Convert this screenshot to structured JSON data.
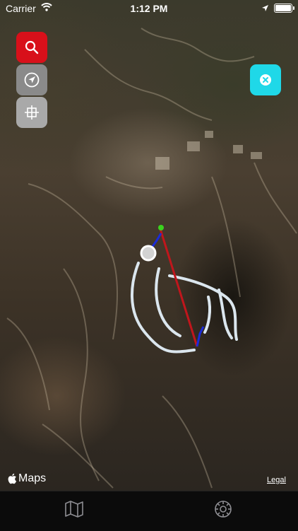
{
  "status_bar": {
    "carrier": "Carrier",
    "time": "1:12 PM",
    "icons": [
      "wifi-icon",
      "location-arrow-icon",
      "battery-icon"
    ]
  },
  "map": {
    "attribution": "Maps",
    "legal_label": "Legal",
    "route_colors": {
      "line": "#c0161c",
      "start": "#3bd21e",
      "end": "#1a2bd9",
      "trail": "#dce7f0"
    }
  },
  "map_controls": {
    "search": {
      "icon": "search-icon",
      "color": "#d8101a"
    },
    "locate": {
      "icon": "location-arrow-icon",
      "color": "#8a8a8a"
    },
    "tracking": {
      "icon": "crosshair-icon",
      "color": "#a9a9a9"
    },
    "close": {
      "icon": "close-icon",
      "color": "#1fd8e8"
    }
  },
  "tab_bar": {
    "items": [
      {
        "icon": "map-icon"
      },
      {
        "icon": "gear-icon"
      }
    ]
  }
}
